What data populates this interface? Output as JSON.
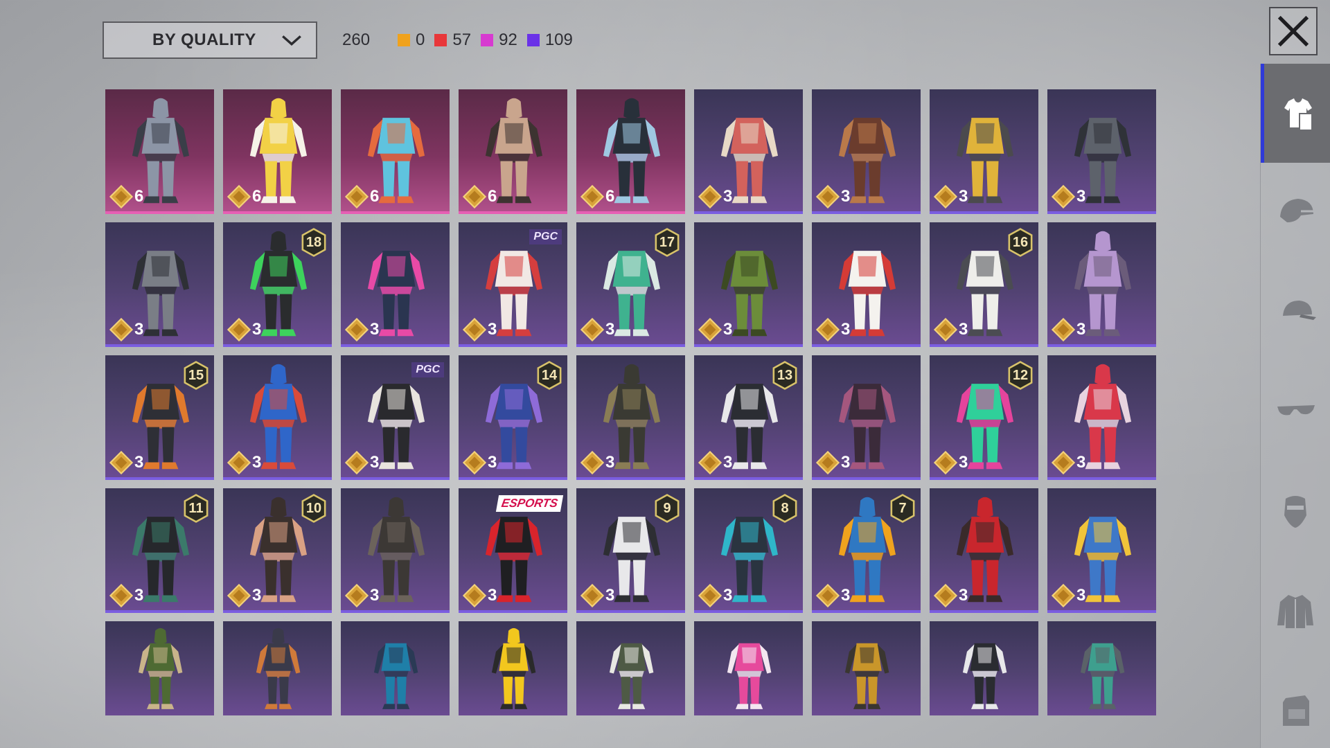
{
  "toolbar": {
    "sort_label": "BY QUALITY",
    "total_count": "260",
    "counts": [
      {
        "color": "#f0a21d",
        "value": "0"
      },
      {
        "color": "#e8373a",
        "value": "57"
      },
      {
        "color": "#d73ad0",
        "value": "92"
      },
      {
        "color": "#6a32e8",
        "value": "109"
      }
    ]
  },
  "colors": {
    "legendary_card": "#b0508a",
    "epic_card": "#6a4b91",
    "sidebar_active": "#2f3ad9"
  },
  "items": [
    {
      "tier": "legendary",
      "cost": "6",
      "palette": [
        "#8c95a6",
        "#3a3e48"
      ],
      "hood": true
    },
    {
      "tier": "legendary",
      "cost": "6",
      "palette": [
        "#f2d146",
        "#f6f2e8"
      ],
      "hood": true
    },
    {
      "tier": "legendary",
      "cost": "6",
      "palette": [
        "#5fc3de",
        "#e56b3e"
      ],
      "hood": false
    },
    {
      "tier": "legendary",
      "cost": "6",
      "palette": [
        "#c9a58d",
        "#3d3331"
      ],
      "hood": true
    },
    {
      "tier": "legendary",
      "cost": "6",
      "palette": [
        "#28303a",
        "#9fc8e2"
      ],
      "hood": true
    },
    {
      "tier": "epic",
      "cost": "3",
      "palette": [
        "#d3625c",
        "#e8d9c6"
      ],
      "hood": false
    },
    {
      "tier": "epic",
      "cost": "3",
      "palette": [
        "#6b3c2d",
        "#b9794a"
      ],
      "hood": false
    },
    {
      "tier": "epic",
      "cost": "3",
      "palette": [
        "#e0b33a",
        "#4b4a4e"
      ],
      "hood": false
    },
    {
      "tier": "epic",
      "cost": "3",
      "palette": [
        "#5d626b",
        "#2f3238"
      ],
      "hood": false
    },
    {
      "tier": "epic",
      "cost": "3",
      "palette": [
        "#7a7e86",
        "#2e3036"
      ],
      "hood": false
    },
    {
      "tier": "epic",
      "cost": "3",
      "badge": "18",
      "palette": [
        "#2a2c2e",
        "#3dd35c"
      ],
      "hood": true
    },
    {
      "tier": "epic",
      "cost": "3",
      "palette": [
        "#2a3550",
        "#e84aa6"
      ],
      "hood": false
    },
    {
      "tier": "epic",
      "cost": "3",
      "tag": "PGC",
      "palette": [
        "#f1e8e4",
        "#d53e3e"
      ],
      "hood": false
    },
    {
      "tier": "epic",
      "cost": "3",
      "badge": "17",
      "palette": [
        "#3fb28f",
        "#dbe9e3"
      ],
      "hood": false
    },
    {
      "tier": "epic",
      "cost": "3",
      "palette": [
        "#6c8d3a",
        "#3c4a22"
      ],
      "hood": false
    },
    {
      "tier": "epic",
      "cost": "3",
      "palette": [
        "#f4f2ee",
        "#d53b36"
      ],
      "hood": false
    },
    {
      "tier": "epic",
      "cost": "3",
      "badge": "16",
      "palette": [
        "#eeeeea",
        "#4b4c52"
      ],
      "hood": false
    },
    {
      "tier": "epic",
      "cost": "3",
      "palette": [
        "#b596cf",
        "#6b5c7a"
      ],
      "hood": true
    },
    {
      "tier": "epic",
      "cost": "3",
      "badge": "15",
      "palette": [
        "#2e2f36",
        "#e07a2d"
      ],
      "hood": false
    },
    {
      "tier": "epic",
      "cost": "3",
      "palette": [
        "#2f66c9",
        "#d94b3a"
      ],
      "hood": true
    },
    {
      "tier": "epic",
      "cost": "3",
      "tag": "PGC",
      "palette": [
        "#2a2a2e",
        "#e8e4de"
      ],
      "hood": false
    },
    {
      "tier": "epic",
      "cost": "3",
      "badge": "14",
      "palette": [
        "#334a9e",
        "#8e6bd8"
      ],
      "hood": false
    },
    {
      "tier": "epic",
      "cost": "3",
      "palette": [
        "#3a3a33",
        "#8a7d55"
      ],
      "hood": true
    },
    {
      "tier": "epic",
      "cost": "3",
      "badge": "13",
      "palette": [
        "#2b2d33",
        "#e8e8ea"
      ],
      "hood": false
    },
    {
      "tier": "epic",
      "cost": "3",
      "palette": [
        "#3b2b3a",
        "#a5577e"
      ],
      "hood": false
    },
    {
      "tier": "epic",
      "cost": "3",
      "badge": "12",
      "palette": [
        "#2fd09a",
        "#e5449c"
      ],
      "hood": false
    },
    {
      "tier": "epic",
      "cost": "3",
      "palette": [
        "#d9384a",
        "#e8d3df"
      ],
      "hood": true
    },
    {
      "tier": "epic",
      "cost": "3",
      "badge": "11",
      "palette": [
        "#26282c",
        "#3b7a6a"
      ],
      "hood": false
    },
    {
      "tier": "epic",
      "cost": "3",
      "badge": "10",
      "palette": [
        "#3a302d",
        "#d9a184"
      ],
      "hood": true
    },
    {
      "tier": "epic",
      "cost": "3",
      "palette": [
        "#3c3835",
        "#6c635b"
      ],
      "hood": true
    },
    {
      "tier": "epic",
      "cost": "3",
      "tag": "ESPORTS",
      "palette": [
        "#1f1f22",
        "#d8242c"
      ],
      "hood": false
    },
    {
      "tier": "epic",
      "cost": "3",
      "badge": "9",
      "palette": [
        "#e8e8ea",
        "#2d2e33"
      ],
      "hood": false
    },
    {
      "tier": "epic",
      "cost": "3",
      "badge": "8",
      "palette": [
        "#2a3440",
        "#2fb6c9"
      ],
      "hood": false
    },
    {
      "tier": "epic",
      "cost": "3",
      "badge": "7",
      "palette": [
        "#2f78c2",
        "#f0a31e"
      ],
      "hood": true
    },
    {
      "tier": "epic",
      "cost": "3",
      "palette": [
        "#c9262d",
        "#3a2a2a"
      ],
      "hood": true
    },
    {
      "tier": "epic",
      "cost": "3",
      "palette": [
        "#3e78c8",
        "#f0c43a"
      ],
      "hood": false
    },
    {
      "tier": "epic",
      "partial": true,
      "palette": [
        "#4e6a33",
        "#c9b48a"
      ],
      "hood": true
    },
    {
      "tier": "epic",
      "partial": true,
      "palette": [
        "#3a3a4a",
        "#d07a3a"
      ],
      "hood": true
    },
    {
      "tier": "epic",
      "partial": true,
      "palette": [
        "#1f7fa8",
        "#2a3a55"
      ],
      "hood": false
    },
    {
      "tier": "epic",
      "partial": true,
      "palette": [
        "#f2c71e",
        "#2a2a2a"
      ],
      "hood": true
    },
    {
      "tier": "epic",
      "partial": true,
      "palette": [
        "#4e5a45",
        "#e8e8e2"
      ],
      "hood": false
    },
    {
      "tier": "epic",
      "partial": true,
      "palette": [
        "#e64a9c",
        "#f3e6f0"
      ],
      "hood": false
    },
    {
      "tier": "epic",
      "partial": true,
      "palette": [
        "#c9962a",
        "#3a3630"
      ],
      "hood": false
    },
    {
      "tier": "epic",
      "partial": true,
      "palette": [
        "#2a2c31",
        "#e8e8ea"
      ],
      "hood": false
    },
    {
      "tier": "epic",
      "partial": true,
      "palette": [
        "#3e9f8e",
        "#5a6268"
      ],
      "hood": false
    }
  ],
  "sidebar": [
    {
      "icon": "outfit-icon",
      "active": true
    },
    {
      "icon": "helmet-icon",
      "active": false
    },
    {
      "icon": "cap-icon",
      "active": false
    },
    {
      "icon": "glasses-icon",
      "active": false
    },
    {
      "icon": "mask-icon",
      "active": false
    },
    {
      "icon": "jacket-icon",
      "active": false
    },
    {
      "icon": "backpack-icon",
      "active": false
    }
  ]
}
